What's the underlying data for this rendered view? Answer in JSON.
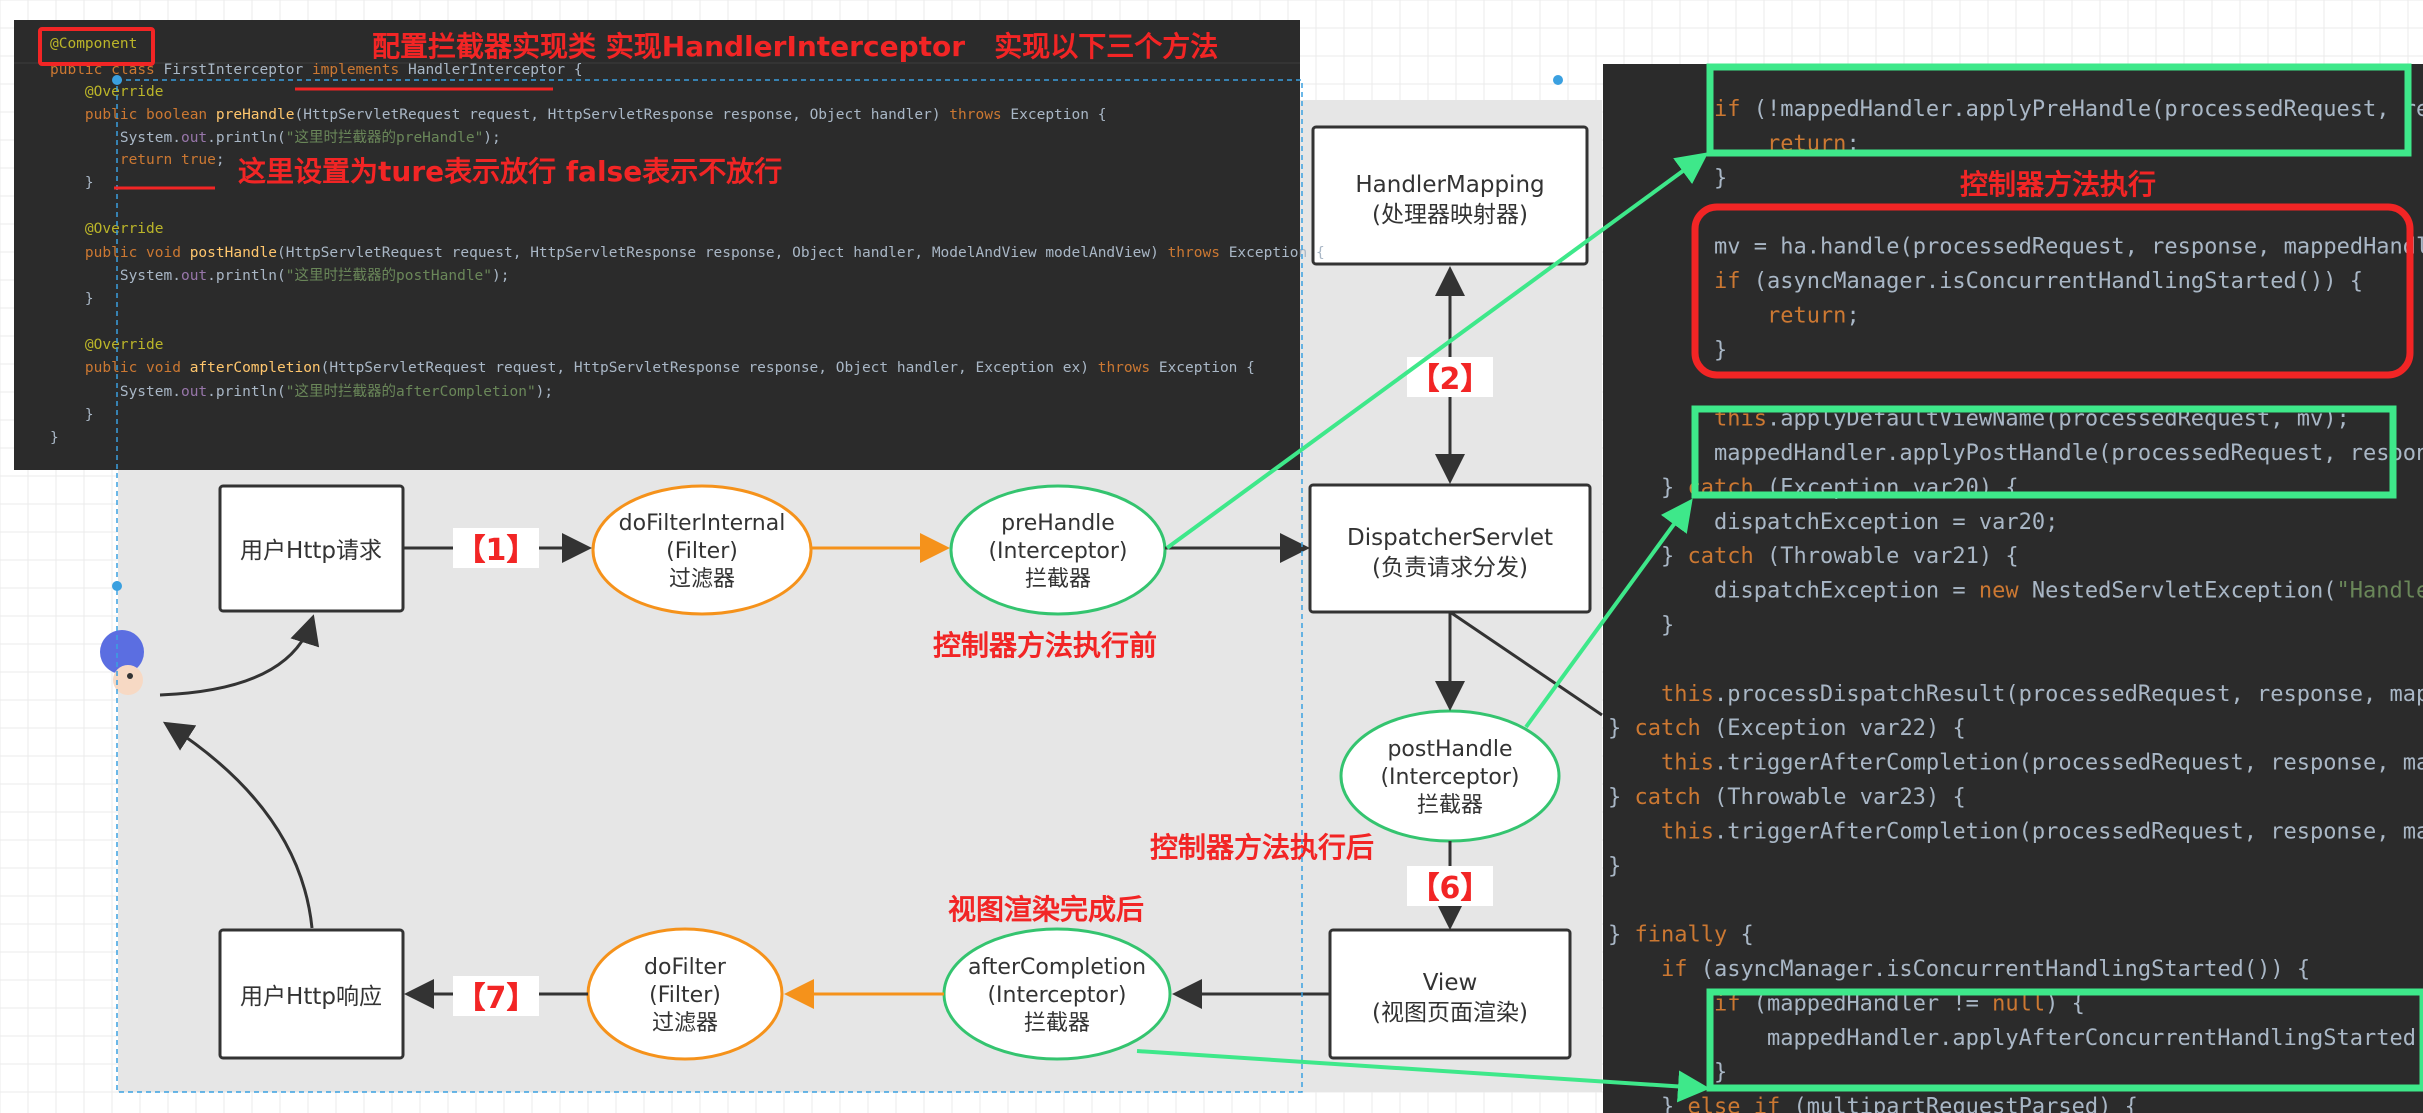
{
  "colors": {
    "code_bg": "#2b2b2b",
    "diagram_bg": "#e6e6e6",
    "annotation_red": "#f22525",
    "green_arrow": "#3ee88a",
    "orange": "#f5921b",
    "ellipse_green": "#34c46f",
    "keyword": "#cc7832",
    "string": "#6a8759",
    "annotation": "#bbb529",
    "method": "#ffc66d",
    "field": "#9876aa"
  },
  "left_code": {
    "lines": [
      [
        "@Component"
      ],
      [
        "public class FirstInterceptor implements HandlerInterceptor {"
      ],
      [
        "    @Override"
      ],
      [
        "    public boolean preHandle(HttpServletRequest request, HttpServletResponse response, Object handler) throws Exception {"
      ],
      [
        "        System.out.println(\"这里时拦截器的preHandle\");"
      ],
      [
        "        return true;"
      ],
      [
        "    }"
      ],
      [
        ""
      ],
      [
        "    @Override"
      ],
      [
        "    public void postHandle(HttpServletRequest request, HttpServletResponse response, Object handler, ModelAndView modelAndView) throws Exception {"
      ],
      [
        "        System.out.println(\"这里时拦截器的postHandle\");"
      ],
      [
        "    }"
      ],
      [
        ""
      ],
      [
        "    @Override"
      ],
      [
        "    public void afterCompletion(HttpServletRequest request, HttpServletResponse response, Object handler, Exception ex) throws Exception {"
      ],
      [
        "        System.out.println(\"这里时拦截器的afterCompletion\");"
      ],
      [
        "    }"
      ],
      [
        "}"
      ]
    ]
  },
  "right_code": {
    "lines": [
      "        if (!mappedHandler.applyPreHandle(processedRequest, re",
      "            return;",
      "        }",
      "",
      "        mv = ha.handle(processedRequest, response, mappedHandl",
      "        if (asyncManager.isConcurrentHandlingStarted()) {",
      "            return;",
      "        }",
      "",
      "        this.applyDefaultViewName(processedRequest, mv);",
      "        mappedHandler.applyPostHandle(processedRequest, respon",
      "    } catch (Exception var20) {",
      "        dispatchException = var20;",
      "    } catch (Throwable var21) {",
      "        dispatchException = new NestedServletException(\"Handle",
      "    }",
      "",
      "    this.processDispatchResult(processedRequest, response, map",
      "} catch (Exception var22) {",
      "    this.triggerAfterCompletion(processedRequest, response, ma",
      "} catch (Throwable var23) {",
      "    this.triggerAfterCompletion(processedRequest, response, ma",
      "}",
      "",
      "} finally {",
      "    if (asyncManager.isConcurrentHandlingStarted()) {",
      "        if (mappedHandler != null) {",
      "            mappedHandler.applyAfterConcurrentHandlingStarted(pro",
      "        }",
      "    } else if (multipartRequestParsed) {"
    ]
  },
  "annotations": {
    "title": "配置拦截器实现类 实现HandlerInterceptor   实现以下三个方法",
    "return_note": "这里设置为ture表示放行 false表示不放行",
    "controller_exec": "控制器方法执行",
    "before_controller": "控制器方法执行前",
    "after_controller": "控制器方法执行后",
    "after_view": "视图渲染完成后"
  },
  "diagram": {
    "user_request": "用户Http请求",
    "user_response": "用户Http响应",
    "do_filter_internal": [
      "doFilterInternal",
      "(Filter)",
      "过滤器"
    ],
    "pre_handle": [
      "preHandle",
      "(Interceptor)",
      "拦截器"
    ],
    "post_handle": [
      "postHandle",
      "(Interceptor)",
      "拦截器"
    ],
    "after_completion": [
      "afterCompletion",
      "(Interceptor)",
      "拦截器"
    ],
    "do_filter": [
      "doFilter",
      "(Filter)",
      "过滤器"
    ],
    "handler_mapping": [
      "HandlerMapping",
      "(处理器映射器)"
    ],
    "dispatcher_servlet": [
      "DispatcherServlet",
      "(负责请求分发)"
    ],
    "view": [
      "View",
      "(视图页面渲染)"
    ],
    "step_labels": [
      "【1】",
      "【2】",
      "【6】",
      "【7】"
    ]
  }
}
